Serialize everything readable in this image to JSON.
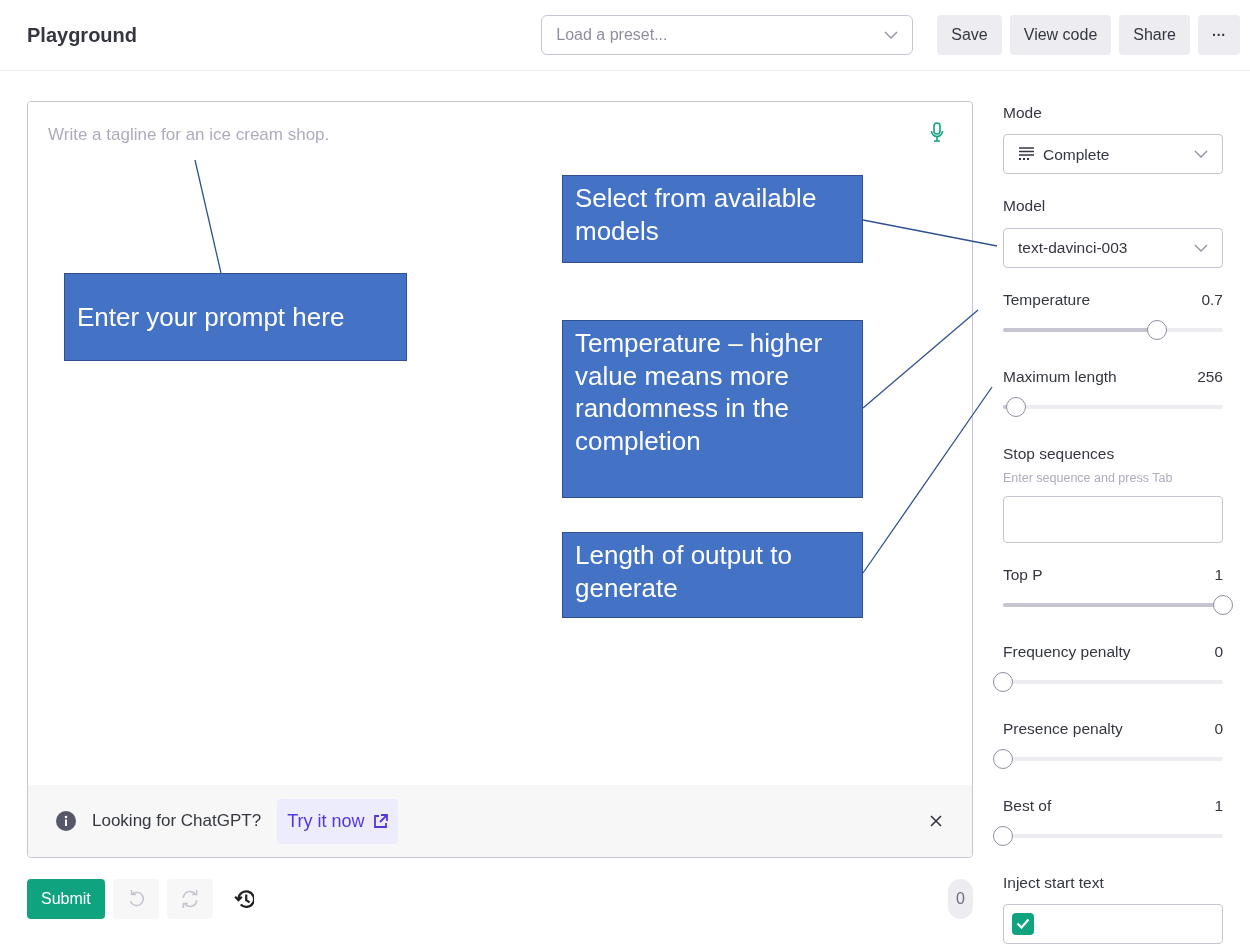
{
  "header": {
    "title": "Playground",
    "preset_select": {
      "placeholder": "Load a preset..."
    },
    "buttons": [
      {
        "kind": "text",
        "label": "Save"
      },
      {
        "kind": "text",
        "label": "View code"
      },
      {
        "kind": "text",
        "label": "Share"
      },
      {
        "kind": "more",
        "label": "···"
      }
    ]
  },
  "prompt": {
    "placeholder": "Write a tagline for an ice cream shop."
  },
  "banner": {
    "text": "Looking for ChatGPT?",
    "link": "Try it now"
  },
  "toolbar": {
    "submit": "Submit",
    "tools": [
      {
        "kind": "undo",
        "disabled": true
      },
      {
        "kind": "redo",
        "disabled": true
      },
      {
        "kind": "history",
        "disabled": false
      }
    ],
    "token_count": "0"
  },
  "sidebar": {
    "mode": {
      "label": "Mode",
      "value": "Complete"
    },
    "model": {
      "label": "Model",
      "value": "text-davinci-003"
    },
    "params": [
      {
        "kind": "slider",
        "label": "Temperature",
        "value": "0.7",
        "level": 0.7
      },
      {
        "kind": "slider",
        "label": "Maximum length",
        "value": "256",
        "level": 0.06
      },
      {
        "kind": "stops",
        "label": "Stop sequences",
        "hint": "Enter sequence and press Tab"
      },
      {
        "kind": "slider",
        "label": "Top P",
        "value": "1",
        "level": 1
      },
      {
        "kind": "slider",
        "label": "Frequency penalty",
        "value": "0",
        "level": 0
      },
      {
        "kind": "slider",
        "label": "Presence penalty",
        "value": "0",
        "level": 0
      },
      {
        "kind": "slider",
        "label": "Best of",
        "value": "1",
        "level": 0
      },
      {
        "kind": "checkbox",
        "label": "Inject start text",
        "checked": true
      }
    ]
  },
  "annotations": [
    {
      "text": "Enter your prompt here"
    },
    {
      "text": "Select from available models"
    },
    {
      "text": "Temperature – higher value means more randomness in the completion"
    },
    {
      "text": "Length of output to generate"
    }
  ]
}
